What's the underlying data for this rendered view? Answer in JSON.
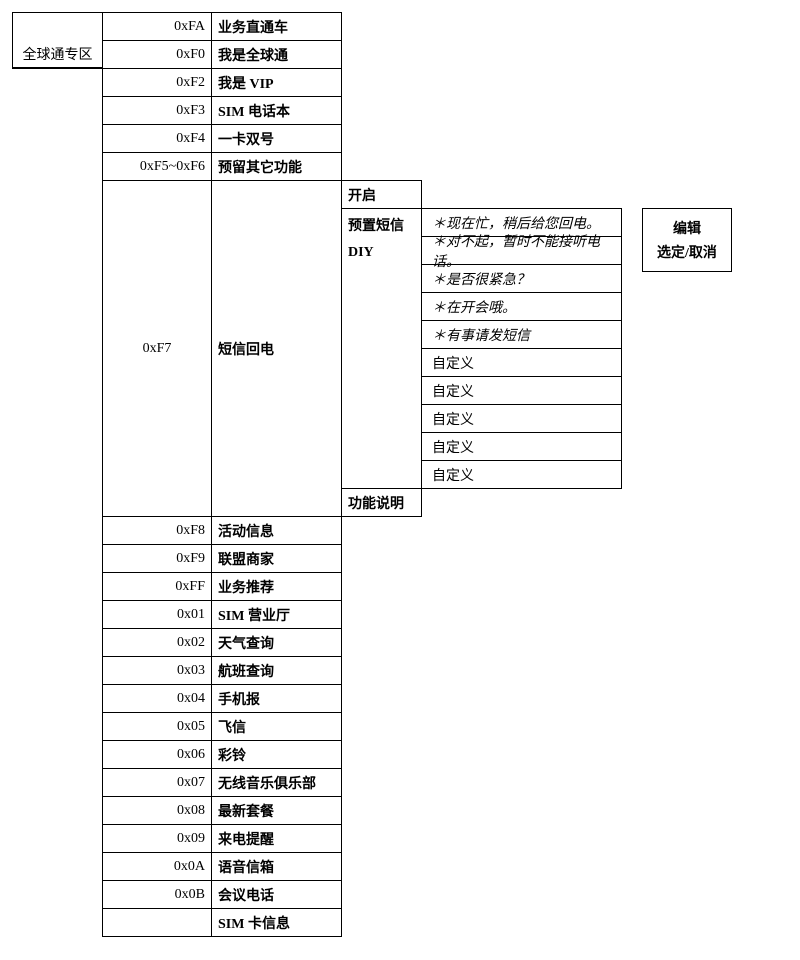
{
  "category": "全球通专区",
  "col2": {
    "r0": "0xFA",
    "r1": "0xF0",
    "r2": "0xF2",
    "r3": "0xF3",
    "r4": "0xF4",
    "r5": "0xF5~0xF6",
    "r6": "0xF7",
    "r7": "0xF8",
    "r8": "0xF9",
    "r9": "0xFF",
    "r10": "0x01",
    "r11": "0x02",
    "r12": "0x03",
    "r13": "0x04",
    "r14": "0x05",
    "r15": "0x06",
    "r16": "0x07",
    "r17": "0x08",
    "r18": "0x09",
    "r19": "0x0A",
    "r20": "0x0B",
    "r21": ""
  },
  "col3": {
    "r0": "业务直通车",
    "r1": "我是全球通",
    "r2": "我是 VIP",
    "r3": "SIM 电话本",
    "r4": "一卡双号",
    "r5": "预留其它功能",
    "r6": "短信回电",
    "r7": "活动信息",
    "r8": "联盟商家",
    "r9": "业务推荐",
    "r10": "SIM 营业厅",
    "r11": "天气查询",
    "r12": "航班查询",
    "r13": "手机报",
    "r14": "飞信",
    "r15": "彩铃",
    "r16": "无线音乐俱乐部",
    "r17": "最新套餐",
    "r18": "来电提醒",
    "r19": "语音信箱",
    "r20": "会议电话",
    "r21": "SIM 卡信息"
  },
  "col4": {
    "r0": "开启",
    "r1a": "预置短信",
    "r1b": "DIY",
    "r2": "功能说明"
  },
  "col5": {
    "m0": "＊现在忙，稍后给您回电。",
    "m1": "＊对不起，暂时不能接听电话。",
    "m2": "＊是否很紧急？",
    "m3": "＊在开会哦。",
    "m4": "＊有事请发短信",
    "m5": "自定义",
    "m6": "自定义",
    "m7": "自定义",
    "m8": "自定义",
    "m9": "自定义"
  },
  "col6": {
    "l0": "编辑",
    "l1": "选定/取消"
  }
}
